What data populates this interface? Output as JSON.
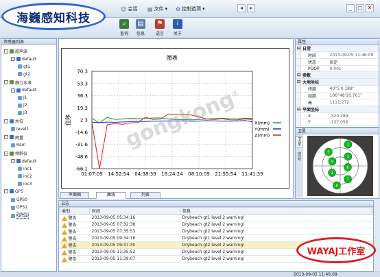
{
  "brand": {
    "text": "海巍感知科技"
  },
  "watermark": {
    "text": "gongkong",
    "mark": "®"
  },
  "badge": {
    "text": "WAYAJ工作室"
  },
  "menus": [
    {
      "label": "会话",
      "icon": "chat-icon"
    },
    {
      "label": "文件",
      "icon": "file-icon"
    },
    {
      "label": "控制选项",
      "icon": "options-icon"
    }
  ],
  "ribbon": [
    {
      "label": "查询",
      "icon": "query-icon",
      "color": "#3a7d3a"
    },
    {
      "label": "信息",
      "icon": "info-icon",
      "color": "#5c7ab0"
    },
    {
      "label": "语言",
      "icon": "language-icon",
      "color": "#c0392b"
    },
    {
      "label": "关于",
      "icon": "about-icon",
      "color": "#2a5db0"
    }
  ],
  "sensor_panel": {
    "title": "传感器列表",
    "tree": [
      {
        "label": "超声波",
        "level": 1,
        "exp": "-",
        "color": "#5a8f3a"
      },
      {
        "label": "default",
        "level": 2,
        "exp": "-",
        "color": "#3a6fb0"
      },
      {
        "label": "gt1",
        "level": 3,
        "exp": "",
        "color": "#6b9bd1"
      },
      {
        "label": "gt2",
        "level": 3,
        "exp": "",
        "color": "#6b9bd1"
      },
      {
        "label": "静力水准",
        "level": 1,
        "exp": "-",
        "color": "#5a8f3a"
      },
      {
        "label": "default",
        "level": 2,
        "exp": "-",
        "color": "#3a6fb0"
      },
      {
        "label": "J1",
        "level": 3,
        "exp": "",
        "color": "#6b9bd1"
      },
      {
        "label": "J2",
        "level": 3,
        "exp": "",
        "color": "#6b9bd1"
      },
      {
        "label": "J3",
        "level": 3,
        "exp": "",
        "color": "#6b9bd1"
      },
      {
        "label": "水位",
        "level": 1,
        "exp": "-",
        "color": "#3a7fc0"
      },
      {
        "label": "level1",
        "level": 2,
        "exp": "",
        "color": "#6b9bd1"
      },
      {
        "label": "雨量",
        "level": 1,
        "exp": "-",
        "color": "#3a6fb0"
      },
      {
        "label": "Rain",
        "level": 2,
        "exp": "",
        "color": "#6b9bd1"
      },
      {
        "label": "倾斜仪",
        "level": 1,
        "exp": "-",
        "color": "#5a8f3a"
      },
      {
        "label": "default",
        "level": 2,
        "exp": "-",
        "color": "#3a6fb0"
      },
      {
        "label": "inc1",
        "level": 3,
        "exp": "",
        "color": "#6b9bd1"
      },
      {
        "label": "inc2",
        "level": 3,
        "exp": "",
        "color": "#6b9bd1"
      },
      {
        "label": "inc3",
        "level": 3,
        "exp": "",
        "color": "#6b9bd1"
      },
      {
        "label": "GPS",
        "level": 1,
        "exp": "-",
        "color": "#2d6fd0"
      },
      {
        "label": "GPS0",
        "level": 2,
        "exp": "",
        "color": "#6b9bd1"
      },
      {
        "label": "GPS1",
        "level": 2,
        "exp": "",
        "color": "#6b9bd1"
      },
      {
        "label": "GPS2",
        "level": 2,
        "exp": "",
        "color": "#6b9bd1",
        "selected": true
      }
    ]
  },
  "chart_data": {
    "type": "line",
    "title": "图表",
    "ylabel": "位移",
    "xlabel": "",
    "yticks": [
      "70.3",
      "53.3",
      "36.3",
      "19.3",
      "2.3",
      "-14.6",
      "-31.6",
      "-48.6",
      "-66.1"
    ],
    "ylim": [
      -66.1,
      70.3
    ],
    "categories": [
      "01:07:09",
      "14:52:54",
      "04:38:39",
      "18:24:24",
      "08:10:09",
      "21:55:54",
      "11:41:39"
    ],
    "grid": true,
    "legend_position": "right",
    "series": [
      {
        "name": "X(mm)",
        "color": "#16a116",
        "values": [
          4.5,
          -2.0,
          5.8,
          3.0,
          3.5,
          4.6,
          4.0,
          4.2,
          5.0,
          5.0,
          3.6,
          2.7,
          2.6,
          2.4,
          2.9,
          3.4,
          2.8,
          3.9,
          2.4,
          2.2,
          3.5,
          2.6
        ]
      },
      {
        "name": "Y(mm)",
        "color": "#1a2ee0",
        "values": [
          -1.0,
          -1.5,
          -0.9,
          -1.2,
          -0.7,
          -0.3,
          -0.1,
          0.0,
          0.4,
          0.6,
          0.7,
          0.7,
          0.9,
          0.3,
          0.6,
          1.1,
          0.8,
          0.6,
          0.5,
          0.8,
          1.2,
          -0.4
        ]
      },
      {
        "name": "Z(mm)",
        "color": "#e01a1a",
        "values": [
          -1.5,
          -66.0,
          -4.5,
          -3.0,
          -4.0,
          -2.0,
          -1.5,
          6.0,
          3.0,
          3.5,
          10.5,
          10.0,
          9.5,
          9.0,
          6.5,
          3.5,
          4.0,
          4.5,
          3.8,
          3.5,
          4.6,
          4.2
        ]
      }
    ]
  },
  "chart_tabs": [
    "平面图",
    "曲线",
    "列表"
  ],
  "properties": {
    "title": "属性",
    "rows": [
      {
        "group": true,
        "key": "日常",
        "value": ""
      },
      {
        "key": "时间",
        "value": "2013-09-05 11:46:09"
      },
      {
        "key": "状态",
        "value": "固定"
      },
      {
        "key": "PDOP",
        "value": "0.001"
      },
      {
        "group": true,
        "key": "参数",
        "value": ""
      },
      {
        "group": true,
        "key": "大地坐标",
        "value": ""
      },
      {
        "key": "纬度",
        "value": "40°5'0.188\""
      },
      {
        "key": "经度",
        "value": "106°48'20.761\""
      },
      {
        "key": "高",
        "value": "1111.272"
      },
      {
        "group": true,
        "key": "平面坐标",
        "value": ""
      },
      {
        "key": "X",
        "value": "-320.289"
      },
      {
        "key": "Y",
        "value": "-137.056"
      }
    ]
  },
  "satellite": {
    "title": "卫星",
    "tabs": [
      "卫星",
      "信号"
    ],
    "sats": [
      {
        "id": "9",
        "el": 60,
        "az": 300
      },
      {
        "id": "5",
        "el": 30,
        "az": 320
      },
      {
        "id": "1",
        "el": 15,
        "az": 20
      },
      {
        "id": "3",
        "el": 50,
        "az": 40
      },
      {
        "id": "6",
        "el": 65,
        "az": 100
      },
      {
        "id": "7",
        "el": 40,
        "az": 150
      },
      {
        "id": "8",
        "el": 25,
        "az": 190
      },
      {
        "id": "2",
        "el": 55,
        "az": 230
      }
    ]
  },
  "log": {
    "title": "日志",
    "headers": [
      "类别",
      "时间",
      "信息"
    ],
    "rows": [
      {
        "type": "警告",
        "time": "2013-09-05 05:34:16",
        "msg": "Drybeach gt1 level 2 warning!"
      },
      {
        "type": "警告",
        "time": "2013-09-05 07:32:38",
        "msg": "Drybeach gt2 level 2 warning!"
      },
      {
        "type": "警告",
        "time": "2013-09-05 07:35:53",
        "msg": "Drybeach gt2 level 2 warning!"
      },
      {
        "type": "警告",
        "time": "2013-09-05 09:34:16",
        "msg": "Drybeach gt1 level 2 warning!"
      },
      {
        "type": "警告",
        "time": "2013-09-05 09:37:30",
        "msg": "Drybeach gt2 level 2 warning!",
        "selected": true
      },
      {
        "type": "警告",
        "time": "2013-09-05 11:35:52",
        "msg": "Drybeach gt2 level 2 warning!"
      },
      {
        "type": "警告",
        "time": "2013-09-05 11:39:07",
        "msg": "Drybeach gt2 level 2 warning!"
      }
    ]
  },
  "status": {
    "text": "2013-09-05 11:46:09"
  }
}
